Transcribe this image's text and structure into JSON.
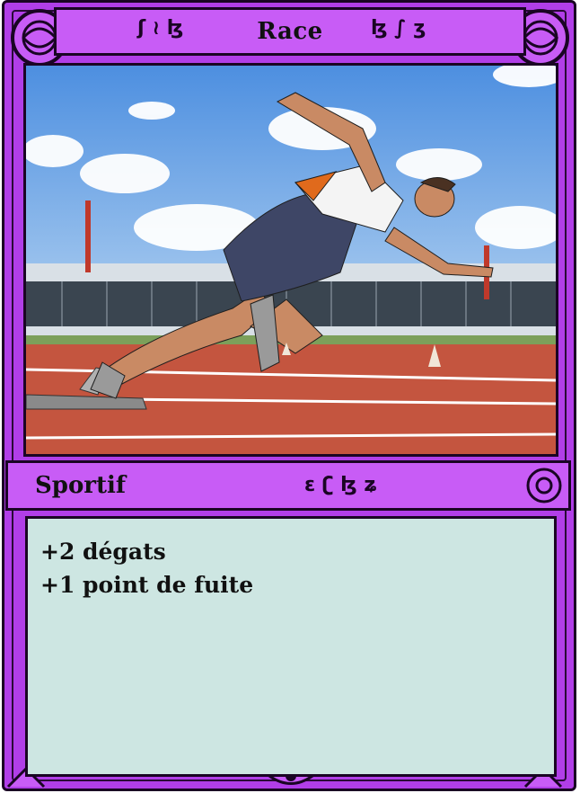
{
  "card": {
    "title": "Race",
    "type_line": "Sportif",
    "effects": [
      "+2 dégats",
      "+1 point de fuite"
    ]
  },
  "illustration": {
    "subject": "sprinter-starting-block-icon"
  },
  "colors": {
    "frame": "#b13ee8",
    "bars": "#c85cf6",
    "text_box": "#cde6e2",
    "outline": "#1a0524"
  }
}
